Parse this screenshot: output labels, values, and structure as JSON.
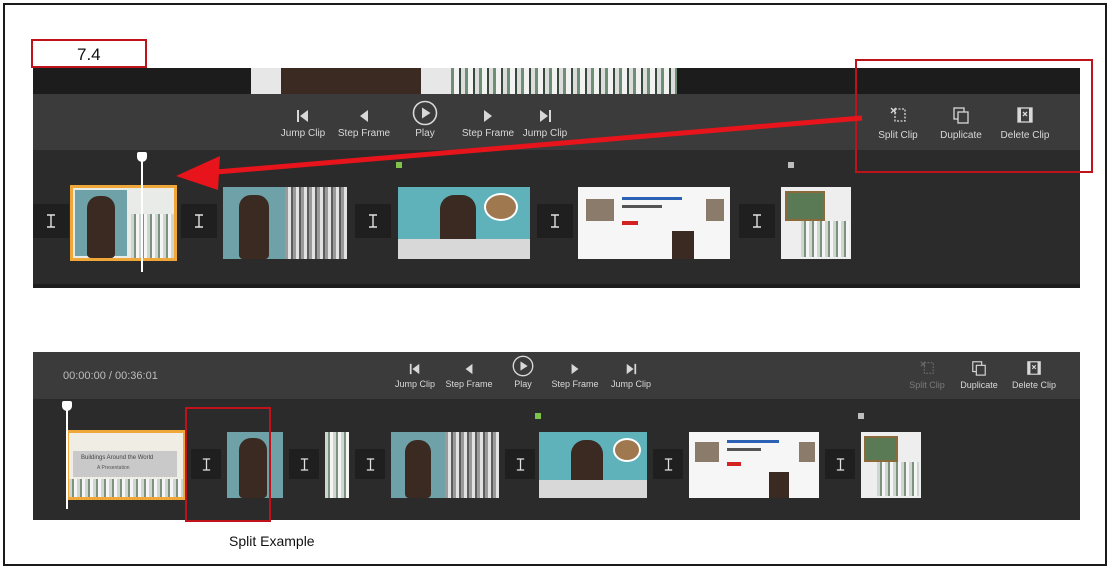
{
  "step_number": "7.4",
  "caption": "Split Example",
  "toolbar_top": {
    "left": [
      {
        "label": "Jump Clip",
        "icon": "skip-back-icon"
      },
      {
        "label": "Step Frame",
        "icon": "step-back-icon"
      },
      {
        "label": "Play",
        "icon": "play-icon"
      },
      {
        "label": "Step Frame",
        "icon": "step-forward-icon"
      },
      {
        "label": "Jump Clip",
        "icon": "skip-forward-icon"
      }
    ],
    "right": [
      {
        "label": "Split Clip",
        "icon": "split-clip-icon",
        "enabled": true
      },
      {
        "label": "Duplicate",
        "icon": "duplicate-icon",
        "enabled": true
      },
      {
        "label": "Delete Clip",
        "icon": "delete-clip-icon",
        "enabled": true
      }
    ]
  },
  "toolbar_bottom": {
    "time": "00:00:00 / 00:36:01",
    "left": [
      {
        "label": "Jump Clip",
        "icon": "skip-back-icon"
      },
      {
        "label": "Step Frame",
        "icon": "step-back-icon"
      },
      {
        "label": "Play",
        "icon": "play-icon"
      },
      {
        "label": "Step Frame",
        "icon": "step-forward-icon"
      },
      {
        "label": "Jump Clip",
        "icon": "skip-forward-icon"
      }
    ],
    "right": [
      {
        "label": "Split Clip",
        "icon": "split-clip-icon",
        "enabled": false
      },
      {
        "label": "Duplicate",
        "icon": "duplicate-icon",
        "enabled": true
      },
      {
        "label": "Delete Clip",
        "icon": "delete-clip-icon",
        "enabled": true
      }
    ]
  },
  "clip_thumbnail_text": {
    "title_slide": "Buildings Around the World",
    "title_slide_sub": "A Presentation"
  },
  "colors": {
    "accent_selected": "#f0a73a",
    "callout_red": "#c0121b",
    "arrow_red": "#e8141c",
    "marker_green": "#7ec44a",
    "marker_gray": "#bdbdbd",
    "panel_bg": "#2b2b2b",
    "toolbar_bg": "#3b3b3b"
  }
}
